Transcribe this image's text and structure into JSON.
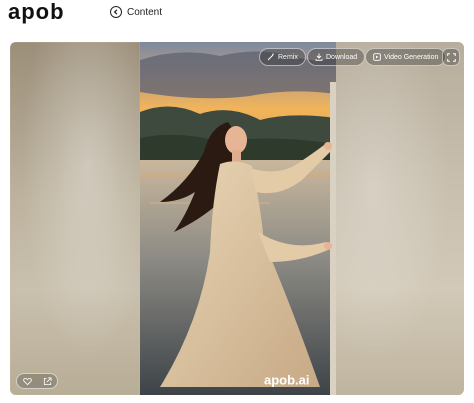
{
  "brand": {
    "logo_text": "apob"
  },
  "header": {
    "back_label": "Content"
  },
  "toolbar": {
    "remix_label": "Remix",
    "download_label": "Download",
    "video_generation_label": "Video Generation"
  },
  "image": {
    "watermark_text": "apob.ai"
  },
  "icons": {
    "back": "chevron-left-circle-icon",
    "remix": "magic-wand-icon",
    "download": "download-icon",
    "video": "video-frame-icon",
    "fullscreen": "fullscreen-icon",
    "like": "heart-icon",
    "share": "share-external-icon"
  }
}
